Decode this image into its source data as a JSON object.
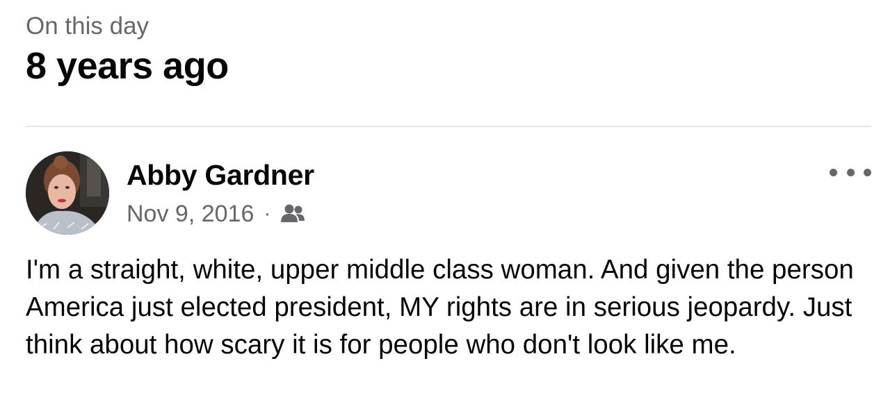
{
  "memory": {
    "kicker": "On this day",
    "title": "8 years ago"
  },
  "post": {
    "author": "Abby Gardner",
    "date": "Nov 9, 2016",
    "separator": "·",
    "audience_icon": "friends-icon",
    "more_icon": "more-options-icon",
    "text": "I'm a straight, white, upper middle class woman. And given the person America just elected president, MY rights are in serious jeopardy. Just think about how scary it is for people who don't look like me."
  },
  "colors": {
    "primary_text": "#050505",
    "secondary_text": "#65676b",
    "divider": "#e4e6eb"
  }
}
